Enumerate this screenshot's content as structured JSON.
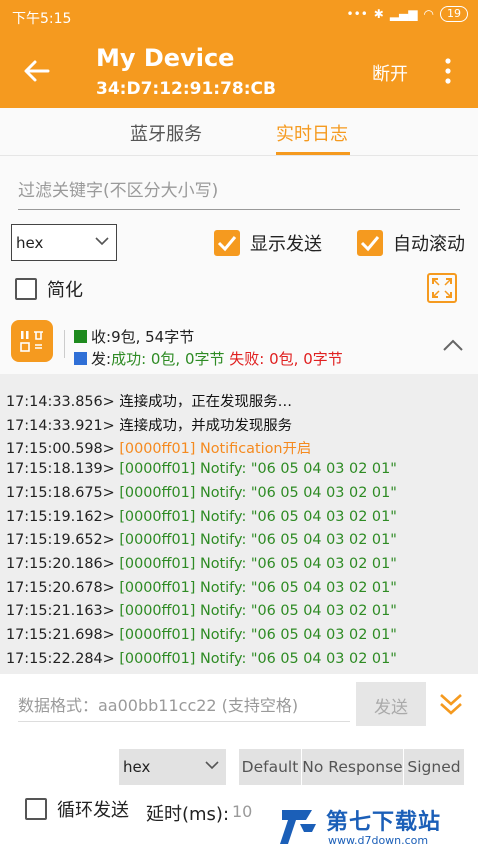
{
  "status_bar": {
    "time": "下午5:15",
    "battery": "19"
  },
  "header": {
    "title": "My Device",
    "mac": "34:D7:12:91:78:CB",
    "disconnect_label": "断开"
  },
  "tabs": [
    {
      "label": "蓝牙服务"
    },
    {
      "label": "实时日志",
      "active": true
    }
  ],
  "filter": {
    "placeholder": "过滤关键字(不区分大小写)"
  },
  "options": {
    "format_selected": "hex",
    "show_send_label": "显示发送",
    "auto_scroll_label": "自动滚动",
    "simplify_label": "简化"
  },
  "stats": {
    "recv_label": "收:",
    "recv_value": "9包, 54字节",
    "send_label": "发:",
    "success_label": "成功: 0包, 0字节",
    "fail_label": "失败: 0包, 0字节"
  },
  "log": [
    {
      "time": "17:14:33.856>",
      "text": "连接成功，正在发现服务…",
      "kind": "black"
    },
    {
      "time": "17:14:33.921>",
      "text": "连接成功，并成功发现服务",
      "kind": "black"
    },
    {
      "time": "17:15:00.598>",
      "text": "[0000ff01] Notification开启",
      "kind": "orange"
    },
    {
      "time": "17:15:18.139>",
      "text": "[0000ff01] Notify: \"06 05 04 03 02 01\"",
      "kind": "green"
    },
    {
      "time": "17:15:18.675>",
      "text": "[0000ff01] Notify: \"06 05 04 03 02 01\"",
      "kind": "green"
    },
    {
      "time": "17:15:19.162>",
      "text": "[0000ff01] Notify: \"06 05 04 03 02 01\"",
      "kind": "green"
    },
    {
      "time": "17:15:19.652>",
      "text": "[0000ff01] Notify: \"06 05 04 03 02 01\"",
      "kind": "green"
    },
    {
      "time": "17:15:20.186>",
      "text": "[0000ff01] Notify: \"06 05 04 03 02 01\"",
      "kind": "green"
    },
    {
      "time": "17:15:20.678>",
      "text": "[0000ff01] Notify: \"06 05 04 03 02 01\"",
      "kind": "green"
    },
    {
      "time": "17:15:21.163>",
      "text": "[0000ff01] Notify: \"06 05 04 03 02 01\"",
      "kind": "green"
    },
    {
      "time": "17:15:21.698>",
      "text": "[0000ff01] Notify: \"06 05 04 03 02 01\"",
      "kind": "green"
    },
    {
      "time": "17:15:22.284>",
      "text": "[0000ff01] Notify: \"06 05 04 03 02 01\"",
      "kind": "green"
    }
  ],
  "send_panel": {
    "data_placeholder": "数据格式：aa00bb11cc22 (支持空格)",
    "send_label": "发送",
    "format_selected": "hex",
    "write_types": [
      "Default",
      "No Response",
      "Signed"
    ],
    "loop_label": "循环发送",
    "delay_label": "延时(ms):",
    "delay_value": "10"
  },
  "watermark": {
    "text": "第七下载站",
    "url": "www.d7down.com"
  },
  "colors": {
    "accent": "#f59a1f",
    "notify_green": "#2e8b24",
    "fail_red": "#e02020"
  }
}
